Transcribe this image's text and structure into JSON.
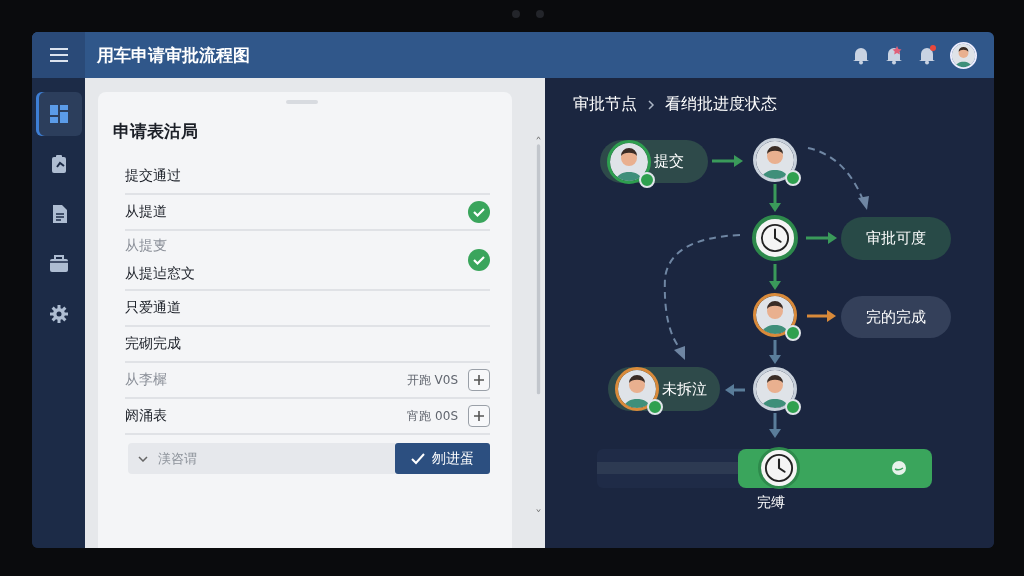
{
  "top_bar": {
    "title": "用车申请审批流程图",
    "notification_badge": true
  },
  "sidebar": {
    "items": [
      {
        "selected": true
      },
      {
        "selected": false
      },
      {
        "selected": false
      },
      {
        "selected": false
      },
      {
        "selected": false
      }
    ]
  },
  "form": {
    "title": "申请表沽局",
    "rows": [
      {
        "kind": "plain",
        "label": "提交通过",
        "muted": false,
        "checked": false
      },
      {
        "kind": "check",
        "label": "从提道",
        "muted": false,
        "checked": true
      },
      {
        "kind": "pair",
        "label": "从提叓",
        "sublabel": "从提迠窓文",
        "muted": true,
        "checked": true
      },
      {
        "kind": "plain",
        "label": "只爱通道",
        "muted": false,
        "checked": false
      },
      {
        "kind": "plain",
        "label": "完砌完成",
        "muted": false,
        "checked": false
      },
      {
        "kind": "counter",
        "label": "从李樨",
        "value": "开跑 V0S",
        "muted": true,
        "checked": false
      },
      {
        "kind": "counter",
        "label": "阏涌表",
        "value": "宵跑 00S",
        "muted": false,
        "checked": false
      }
    ],
    "field": {
      "placeholder": "渼咨谓"
    },
    "button": {
      "label": "刎进蛋"
    }
  },
  "flow": {
    "breadcrumb": [
      "审批节点",
      "看绡批进度状态"
    ],
    "nodes": [
      {
        "kind": "person",
        "label": "提交",
        "color": "#2e9e4f",
        "online": true
      },
      {
        "kind": "person",
        "color": "#c9d1db",
        "online": true
      },
      {
        "kind": "clock",
        "color": "#2e8a4c"
      },
      {
        "kind": "label",
        "label": "审批可度",
        "color": "#284a47"
      },
      {
        "kind": "person",
        "color": "#d98a3a",
        "online": true
      },
      {
        "kind": "label",
        "label": "完的完成",
        "color": "#34405a"
      },
      {
        "kind": "person",
        "label": "未拆泣",
        "color": "#d98a3a",
        "online": true
      },
      {
        "kind": "person",
        "color": "#c9d1db",
        "online": true
      }
    ],
    "timeline": {
      "label": "完缚"
    }
  }
}
